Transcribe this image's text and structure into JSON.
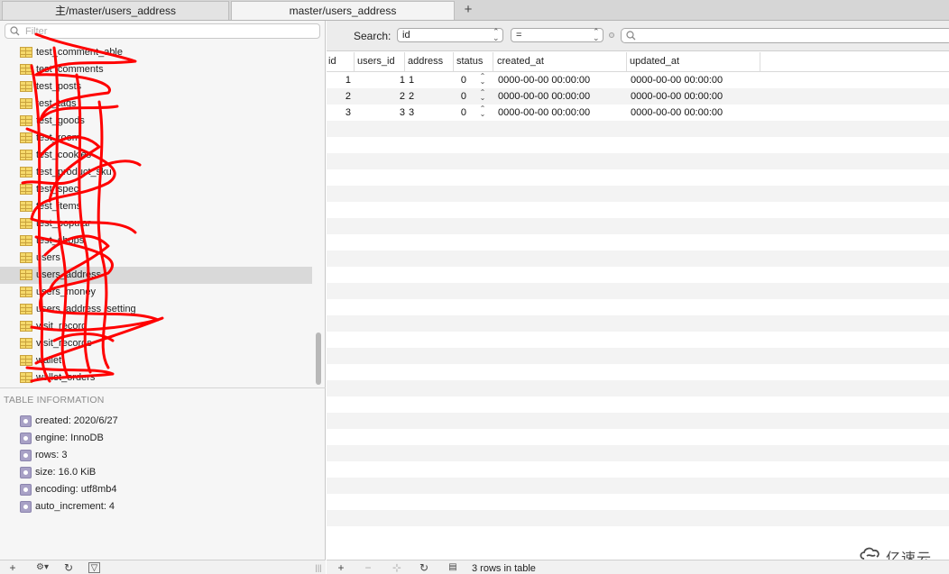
{
  "tabs": [
    {
      "label": "主/master/users_address"
    },
    {
      "label": "master/users_address"
    }
  ],
  "tab_add_label": "+",
  "sidebar": {
    "filter_placeholder": "Filter",
    "tables": [
      {
        "label": "test_comment_able"
      },
      {
        "label": "test_comments"
      },
      {
        "label": "test_posts"
      },
      {
        "label": "test_tags"
      },
      {
        "label": "test_goods"
      },
      {
        "label": "test_room"
      },
      {
        "label": "test_cookies"
      },
      {
        "label": "test_product_sku"
      },
      {
        "label": "test_spec"
      },
      {
        "label": "test_items"
      },
      {
        "label": "test_popular"
      },
      {
        "label": "test_shops"
      },
      {
        "label": "users"
      },
      {
        "label": "users_address",
        "selected": true
      },
      {
        "label": "users_money"
      },
      {
        "label": "users_address_setting"
      },
      {
        "label": "visit_record"
      },
      {
        "label": "visit_records"
      },
      {
        "label": "wallet"
      },
      {
        "label": "wallet_orders"
      }
    ],
    "info_title": "TABLE INFORMATION",
    "info": [
      {
        "text": "created: 2020/6/27"
      },
      {
        "text": "engine: InnoDB"
      },
      {
        "text": "rows: 3"
      },
      {
        "text": "size: 16.0 KiB"
      },
      {
        "text": "encoding: utf8mb4"
      },
      {
        "text": "auto_increment: 4"
      }
    ],
    "footer_buttons": [
      "+",
      "⚙▾",
      "↻",
      "▽"
    ]
  },
  "search": {
    "label": "Search:",
    "field_value": "id",
    "operator_value": "=",
    "query_value": ""
  },
  "grid": {
    "columns": [
      "id",
      "users_id",
      "address",
      "status",
      "created_at",
      "updated_at"
    ],
    "rows": [
      {
        "id": "1",
        "users_id": "1",
        "address": "1",
        "status": "0",
        "created_at": "0000-00-00 00:00:00",
        "updated_at": "0000-00-00 00:00:00"
      },
      {
        "id": "2",
        "users_id": "2",
        "address": "2",
        "status": "0",
        "created_at": "0000-00-00 00:00:00",
        "updated_at": "0000-00-00 00:00:00"
      },
      {
        "id": "3",
        "users_id": "3",
        "address": "3",
        "status": "0",
        "created_at": "0000-00-00 00:00:00",
        "updated_at": "0000-00-00 00:00:00"
      }
    ]
  },
  "footer": {
    "buttons": [
      "+",
      "−",
      "⊹",
      "↻"
    ],
    "status": "3 rows in table"
  },
  "watermark": "亿速云"
}
